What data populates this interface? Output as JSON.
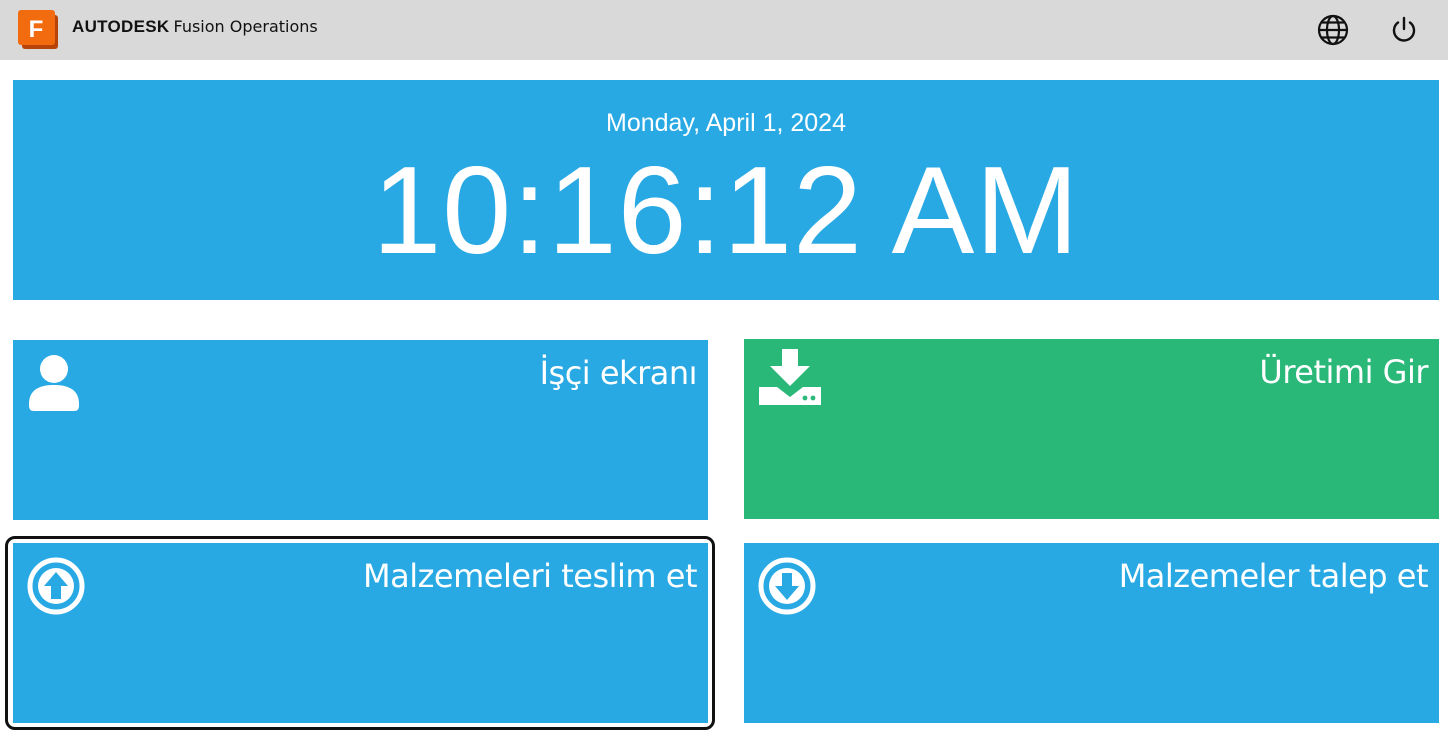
{
  "header": {
    "brand_name": "AUTODESK",
    "product_name": "Fusion Operations",
    "logo_letter": "F",
    "logo_color": "#f26b0f",
    "background": "#d9d9d9",
    "icons": [
      "globe-icon",
      "power-icon"
    ]
  },
  "clock": {
    "date": "Monday, April 1, 2024",
    "time": "10:16:12 AM",
    "background": "#29a9e4"
  },
  "tiles": [
    {
      "label": "İşçi ekranı",
      "icon": "user-icon",
      "color": "#29a9e4"
    },
    {
      "label": "Üretimi Gir",
      "icon": "download-tray-icon",
      "color": "#29b878"
    },
    {
      "label": "Malzemeleri teslim et",
      "icon": "arrow-up-circle-icon",
      "color": "#29a9e4",
      "focused": true
    },
    {
      "label": "Malzemeler talep et",
      "icon": "arrow-down-circle-icon",
      "color": "#29a9e4"
    }
  ]
}
